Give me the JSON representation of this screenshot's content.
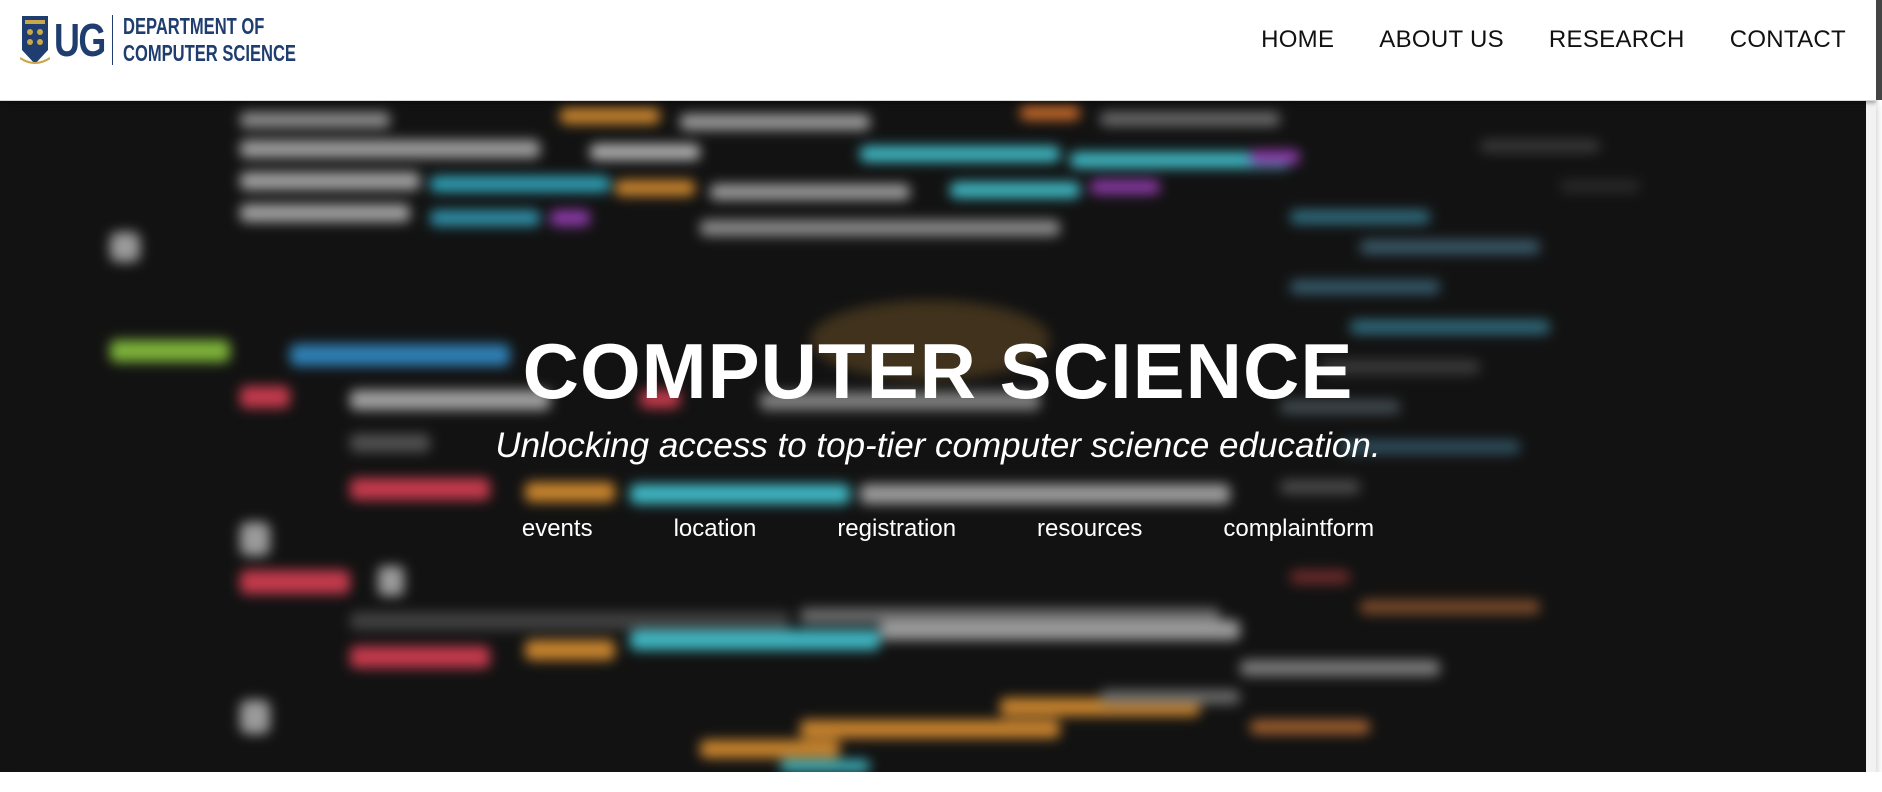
{
  "header": {
    "logo": {
      "short": "UG",
      "line1": "DEPARTMENT OF",
      "line2": "COMPUTER SCIENCE"
    },
    "nav": [
      {
        "label": "HOME"
      },
      {
        "label": "ABOUT US"
      },
      {
        "label": "RESEARCH"
      },
      {
        "label": "CONTACT"
      }
    ]
  },
  "hero": {
    "title": "COMPUTER SCIENCE",
    "subtitle": "Unlocking access to top-tier computer science education.",
    "links": [
      {
        "label": "events"
      },
      {
        "label": "location"
      },
      {
        "label": "registration"
      },
      {
        "label": "resources"
      },
      {
        "label": "complaintform"
      }
    ],
    "background": "blurred-code-image"
  },
  "colors": {
    "brand_navy": "#1f3d6e",
    "hero_bg": "#121212",
    "nav_text": "#111111",
    "hero_text": "#ffffff"
  }
}
